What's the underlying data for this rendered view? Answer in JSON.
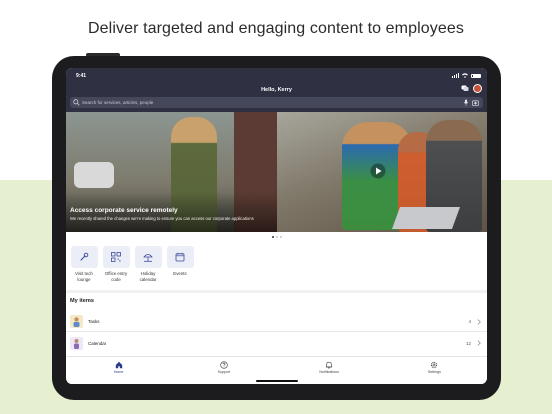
{
  "marketing": {
    "headline": "Deliver targeted and engaging content to employees"
  },
  "status_bar": {
    "time": "9:41"
  },
  "header": {
    "greeting": "Hello, Kerry"
  },
  "search": {
    "placeholder": "Search for services, articles, people"
  },
  "hero": {
    "title": "Access corporate service remotely",
    "subtitle": "We recently shared the changes we're making to ensure you can access our corporate applications"
  },
  "quick_links": [
    {
      "label": "Visit tech lounge",
      "icon": "wrench-icon"
    },
    {
      "label": "Office entry code",
      "icon": "qr-code-icon"
    },
    {
      "label": "Holiday calendar",
      "icon": "beach-umbrella-icon"
    },
    {
      "label": "Events",
      "icon": "calendar-icon"
    }
  ],
  "my_items": {
    "title": "My items",
    "rows": [
      {
        "label": "Tasks",
        "count": "4"
      },
      {
        "label": "Calendar",
        "count": "12"
      }
    ]
  },
  "tabbar": {
    "tabs": [
      {
        "label": "Home",
        "icon": "home-icon",
        "active": true
      },
      {
        "label": "Support",
        "icon": "question-icon",
        "active": false
      },
      {
        "label": "Notifications",
        "icon": "bell-icon",
        "active": false
      },
      {
        "label": "Settings",
        "icon": "gear-icon",
        "active": false
      }
    ]
  },
  "colors": {
    "header_bg": "#2f3142",
    "accent": "#2c3a8c",
    "marketing_bg": "#e6efcf"
  }
}
